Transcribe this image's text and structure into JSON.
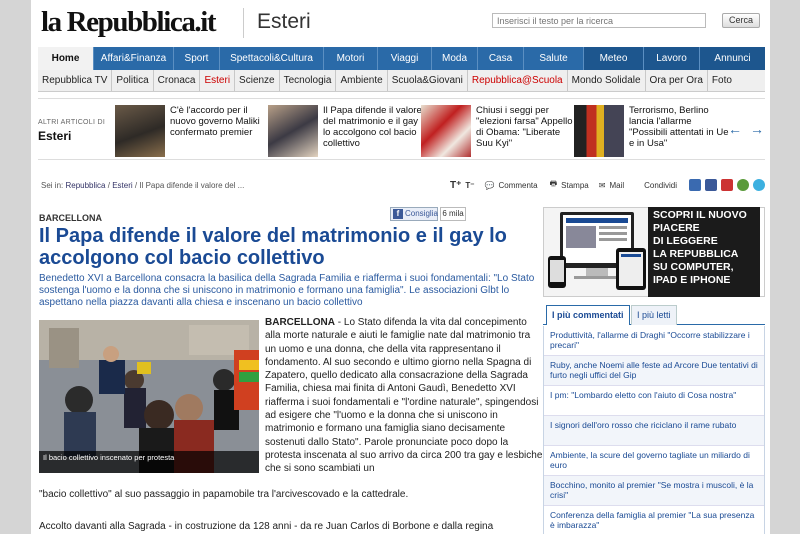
{
  "header": {
    "logo": "la Repubblica.it",
    "section": "Esteri",
    "search_placeholder": "Inserisci il testo per la ricerca",
    "search_button": "Cerca"
  },
  "nav_main": [
    "Home",
    "Affari&Finanza",
    "Sport",
    "Spettacoli&Cultura",
    "Motori",
    "Viaggi",
    "Moda",
    "Casa",
    "Salute",
    "Meteo",
    "Lavoro",
    "Annunci"
  ],
  "nav_sub": [
    "Repubblica TV",
    "Politica",
    "Cronaca",
    "Esteri",
    "Scienze",
    "Tecnologia",
    "Ambiente",
    "Scuola&Giovani",
    "Repubblica@Scuola",
    "Mondo Solidale",
    "Ora per Ora",
    "Foto"
  ],
  "other_articles": {
    "label_small": "ALTRI ARTICOLI DI",
    "label_big": "Esteri",
    "prev": "←",
    "next": "→",
    "items": [
      {
        "text": "C'è l'accordo per il nuovo governo Maliki confermato premier"
      },
      {
        "text": "Il Papa difende il valore del matrimonio e il gay lo accolgono col bacio collettivo"
      },
      {
        "text": "Chiusi i seggi per \"elezioni farsa\" Appello di Obama: \"Liberate Suu Kyi\""
      },
      {
        "text": "Terrorismo, Berlino lancia l'allarme \"Possibili attentati in Ue e in Usa\""
      }
    ]
  },
  "breadcrumb": {
    "prefix": "Sei in:",
    "items": [
      "Repubblica",
      "Esteri",
      "Il Papa difende il valore del ..."
    ],
    "sep": "/"
  },
  "tools": {
    "comment": "Commenta",
    "print": "Stampa",
    "mail": "Mail",
    "share": "Condividi"
  },
  "article": {
    "kicker": "BARCELLONA",
    "fb_label": "Consiglia",
    "fb_count": "6 mila",
    "title": "Il Papa difende il valore del matrimonio e il gay lo accolgono col bacio collettivo",
    "subtitle": "Benedetto XVI a Barcellona consacra la basilica della Sagrada Familia e riafferma i suoi fondamentali: \"Lo Stato sostenga l'uomo e la donna che si uniscono in matrimonio e formano una famiglia\". Le associazioni Glbt lo aspettano nella piazza davanti alla chiesa e inscenano un bacio collettivo",
    "caption": "Il bacio collettivo inscenato per protesta",
    "body_lead": "BARCELLONA",
    "body_text": " - Lo Stato difenda la vita dal concepimento alla morte naturale e aiuti le famiglie nate dal matrimonio tra un uomo e una donna, che della vita rappresentano il fondamento. Al suo secondo e ultimo giorno nella Spagna di Zapatero, quello dedicato alla consacrazione della Sagrada Familia, chiesa mai finita di Antoni Gaudì, Benedetto XVI riafferma i suoi fondamentali e \"l'ordine naturale\", spingendosi ad esigere che \"l'uomo e la donna che si uniscono in matrimonio e formano una famiglia siano decisamente sostenuti dallo Stato\". Parole pronunciate poco dopo la protesta inscenata al suo arrivo da circa 200 tra gay e lesbiche che si sono scambiati un",
    "body_text2": "\"bacio collettivo\" al suo passaggio in papamobile tra l'arcivescovado e la cattedrale.",
    "body_text3": "Accolto davanti alla Sagrada - in costruzione da 128 anni - da re Juan Carlos di Borbone e dalla regina"
  },
  "promo": {
    "lines": [
      "SCOPRI IL NUOVO",
      "PIACERE",
      "DI LEGGERE",
      "LA REPUBBLICA",
      "SU COMPUTER,",
      "IPAD E IPHONE"
    ]
  },
  "tabs": {
    "active": "I più commentati",
    "inactive": "I più letti"
  },
  "most_commented": [
    "Produttività, l'allarme di Draghi \"Occorre stabilizzare i precari\"",
    "Ruby, anche Noemi alle feste ad Arcore Due tentativi di furto negli uffici del Gip",
    "I pm: \"Lombardo eletto con l'aiuto di Cosa nostra\"",
    "I signori dell'oro rosso che riciclano il rame rubato",
    "Ambiente, la scure del governo tagliate un miliardo di euro",
    "Bocchino, monito al premier \"Se mostra i muscoli, è la crisi\"",
    "Conferenza della famiglia al premier \"La sua presenza è imbarazza\""
  ],
  "colors": {
    "nav_blue": "#2a6aa8",
    "title_blue": "#1a4a94",
    "red_section": "#c00"
  }
}
